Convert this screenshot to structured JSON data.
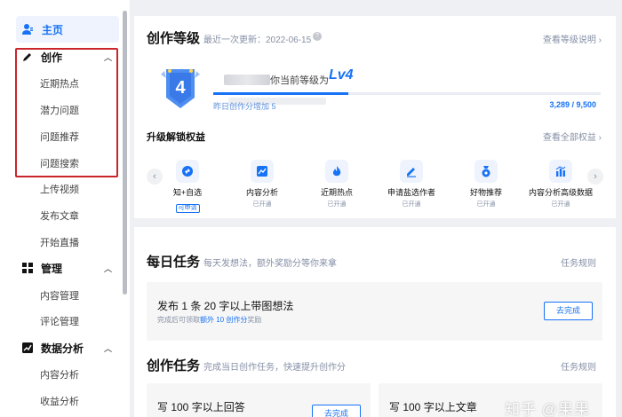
{
  "sidebar": {
    "home": "主页",
    "create": {
      "label": "创作",
      "items": [
        "近期热点",
        "潜力问题",
        "问题推荐",
        "问题搜索",
        "上传视频",
        "发布文章",
        "开始直播"
      ]
    },
    "manage": {
      "label": "管理",
      "items": [
        "内容管理",
        "评论管理"
      ]
    },
    "analytics": {
      "label": "数据分析",
      "items": [
        "内容分析",
        "收益分析"
      ]
    }
  },
  "level_card": {
    "title": "创作等级",
    "updated": "最近一次更新：2022-06-15",
    "view_desc": "查看等级说明",
    "badge_number": "4",
    "current_level_text": "你当前等级为",
    "current_level": "Lv4",
    "progress": 0.3475,
    "yesterday": "昨日创作分增加 5",
    "score": "3,289 / 9,500",
    "unlock_title": "升级解锁权益",
    "view_all": "查看全部权益",
    "benefits": [
      {
        "name": "知+自选",
        "status": "可申请",
        "icon": "link-icon"
      },
      {
        "name": "内容分析",
        "status": "已开通",
        "icon": "chart-icon"
      },
      {
        "name": "近期热点",
        "status": "已开通",
        "icon": "flame-icon"
      },
      {
        "name": "申请盐选作者",
        "status": "已开通",
        "icon": "pen-icon"
      },
      {
        "name": "好物推荐",
        "status": "已开通",
        "icon": "bag-icon"
      },
      {
        "name": "内容分析高级数据",
        "status": "已开通",
        "icon": "bar-chart-icon"
      }
    ]
  },
  "daily_tasks": {
    "title": "每日任务",
    "subtitle": "每天发想法，额外奖励分等你来拿",
    "rules": "任务规则",
    "task": {
      "title": "发布 1 条 20 字以上带图想法",
      "desc_prefix": "完成后可领取",
      "desc_highlight": "额外 10 创作分",
      "desc_suffix": "奖励",
      "button": "去完成"
    }
  },
  "creation_tasks": {
    "title": "创作任务",
    "subtitle": "完成当日创作任务，快速提升创作分",
    "rules": "任务规则",
    "task_a": {
      "title": "写 100 字以上回答",
      "button": "去完成"
    },
    "task_b": {
      "title": "写 100 字以上文章"
    }
  },
  "watermark": "知乎 @果果",
  "colors": {
    "accent": "#1772f6",
    "highlight_box": "#c9252b"
  }
}
